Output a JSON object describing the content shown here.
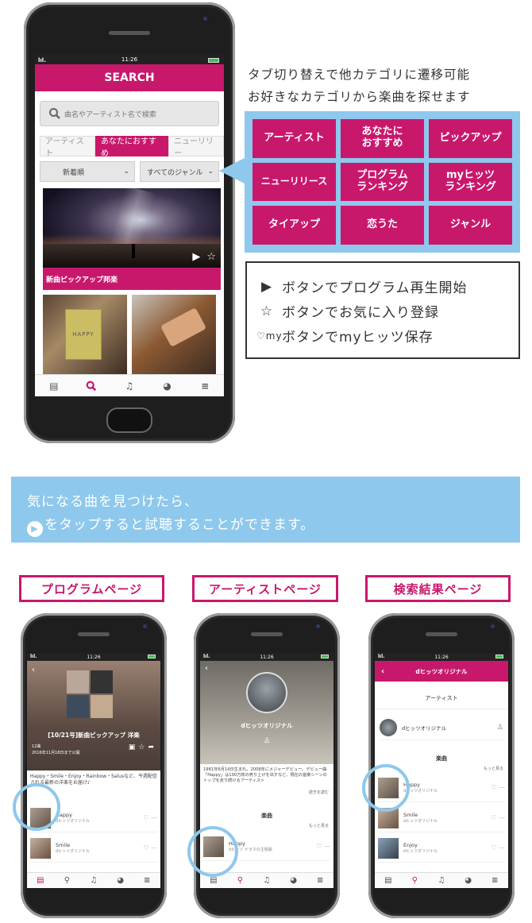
{
  "main_phone": {
    "status_time": "11:26",
    "title": "SEARCH",
    "search_placeholder": "曲名やアーティスト名で検索",
    "tabs": [
      "アーティスト",
      "あなたにおすすめ",
      "ニューリリー"
    ],
    "filters": [
      "新着順",
      "すべてのジャンル"
    ],
    "hero_caption": "新曲ピックアップ邦楽",
    "thumb_book_text": "HAPPY"
  },
  "headline": [
    "タブ切り替えで他カテゴリに遷移可能",
    "お好きなカテゴリから楽曲を探せます"
  ],
  "categories": [
    "アーティスト",
    "あなたに\nおすすめ",
    "ピックアップ",
    "ニューリリース",
    "プログラム\nランキング",
    "myヒッツ\nランキング",
    "タイアップ",
    "恋うた",
    "ジャンル"
  ],
  "legend": [
    {
      "icon": "▶",
      "text": "ボタンでプログラム再生開始"
    },
    {
      "icon": "☆",
      "text": "ボタンでお気に入り登録"
    },
    {
      "icon": "♡my",
      "text": "ボタンでmyヒッツ保存"
    }
  ],
  "banner": {
    "line1": "気になる曲を見つけたら、",
    "line2": "をタップすると試聴することができます。"
  },
  "page_labels": [
    "プログラムページ",
    "アーティストページ",
    "検索結果ページ"
  ],
  "program_page": {
    "status_time": "11:26",
    "title": "[10/21号]新曲ピックアップ 洋楽",
    "count": "12曲",
    "date": "2016年11月18日まで公開",
    "desc": "Happy・Smile・Enjoy・Rainbow・Salusなど、今週配信される最新の洋楽をお届け♪",
    "rows": [
      {
        "title": "Happy",
        "sub": "dヒッツオリジナル"
      },
      {
        "title": "Smile",
        "sub": "dヒッツオリジナル"
      }
    ]
  },
  "artist_page": {
    "status_time": "11:26",
    "name": "dヒッツオリジナル",
    "bio": "1981年6月14日生まれ。2008年にメジャーデビュー。デビュー曲「Happy」は100万枚の売り上げを出すなど、現在の音楽シーンのトップを走り続けるアーティスト",
    "more": "続きを読む",
    "section": "楽曲",
    "more2": "もっと見る",
    "rows": [
      {
        "title": "Happy",
        "sub": "dヒッツ ドラマの主題歌"
      }
    ]
  },
  "search_page": {
    "status_time": "11:26",
    "title": "dヒッツオリジナル",
    "artist_section": "アーティスト",
    "artist_name": "dヒッツオリジナル",
    "song_section": "楽曲",
    "more": "もっと見る",
    "rows": [
      {
        "title": "Happy",
        "sub": "dヒッツオリジナル"
      },
      {
        "title": "Smile",
        "sub": "dヒッツオリジナル"
      },
      {
        "title": "Enjoy",
        "sub": "dヒッツオリジナル"
      }
    ]
  },
  "colors": {
    "accent": "#c8186c",
    "panel": "#8ec8ec"
  }
}
